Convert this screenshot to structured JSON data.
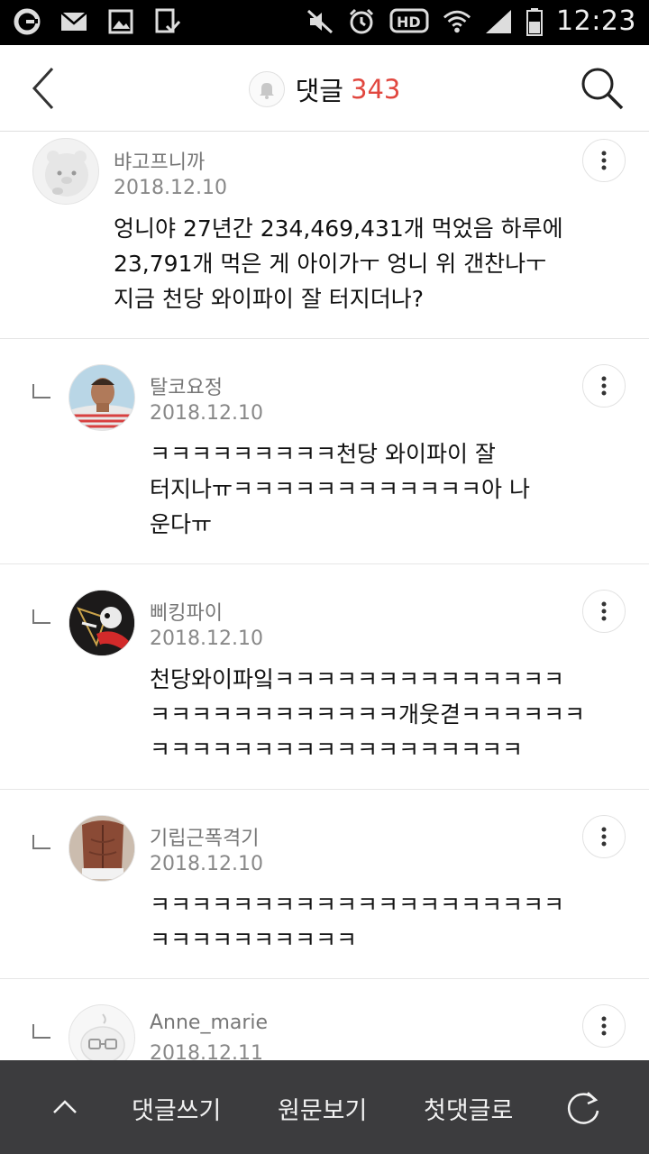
{
  "status_bar": {
    "time": "12:23",
    "left_icons": [
      "g-logo-icon",
      "mail-icon",
      "image-icon",
      "download-check-icon"
    ],
    "right_icons": [
      "mute-icon",
      "alarm-icon",
      "hd-icon",
      "wifi-icon",
      "signal-icon",
      "battery-icon"
    ]
  },
  "header": {
    "title": "댓글",
    "count": "343",
    "accent_color": "#e1473f"
  },
  "comments": [
    {
      "author": "뱌고프니까",
      "date": "2018.12.10",
      "text_lines": [
        "엉니야 27년간 234,469,431개 먹었음 하루에",
        "23,791개 먹은 게 아이가ㅜ 엉니 위 갠찬나ㅜ",
        "지금 천당 와이파이 잘 터지더나?"
      ],
      "is_reply": false
    },
    {
      "author": "탈코요정",
      "date": "2018.12.10",
      "text_lines": [
        "ㅋㅋㅋㅋㅋㅋㅋㅋㅋ천당 와이파이 잘",
        "터지나ㅠㅋㅋㅋㅋㅋㅋㅋㅋㅋㅋㅋㅋ아 나",
        "운다ㅠ"
      ],
      "is_reply": true
    },
    {
      "author": "삐킹파이",
      "date": "2018.12.10",
      "text_lines": [
        "천당와이파잌ㅋㅋㅋㅋㅋㅋㅋㅋㅋㅋㅋㅋㅋㅋ",
        "ㅋㅋㅋㅋㅋㅋㅋㅋㅋㅋㅋㅋ개웃겯ㅋㅋㅋㅋㅋㅋ",
        "ㅋㅋㅋㅋㅋㅋㅋㅋㅋㅋㅋㅋㅋㅋㅋㅋㅋㅋ"
      ],
      "is_reply": true
    },
    {
      "author": "기립근폭격기",
      "date": "2018.12.10",
      "text_lines": [
        "ㅋㅋㅋㅋㅋㅋㅋㅋㅋㅋㅋㅋㅋㅋㅋㅋㅋㅋㅋㅋ",
        "ㅋㅋㅋㅋㅋㅋㅋㅋㅋㅋ"
      ],
      "is_reply": true
    },
    {
      "author": "Anne_marie",
      "date": "2018.12.11",
      "text_lines": [],
      "is_reply": true
    }
  ],
  "bottom_bar": {
    "write": "댓글쓰기",
    "original": "원문보기",
    "first_comment": "첫댓글로"
  }
}
